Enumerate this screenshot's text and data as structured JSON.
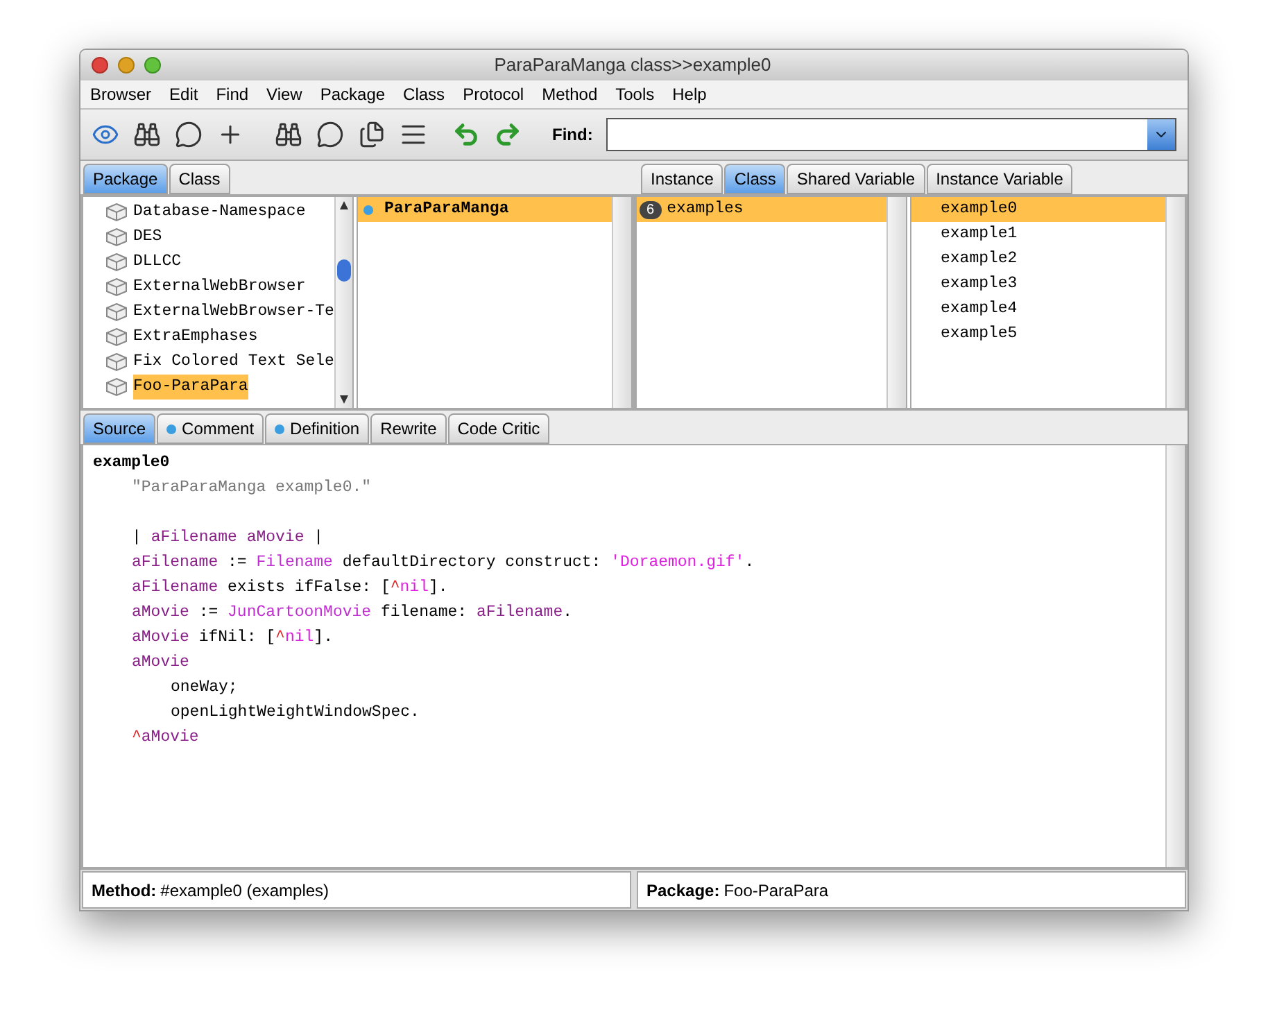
{
  "window": {
    "title": "ParaParaManga class>>example0"
  },
  "menu": [
    "Browser",
    "Edit",
    "Find",
    "View",
    "Package",
    "Class",
    "Protocol",
    "Method",
    "Tools",
    "Help"
  ],
  "find": {
    "label": "Find:"
  },
  "left_tabs": [
    {
      "label": "Package",
      "selected": true
    },
    {
      "label": "Class",
      "selected": false
    }
  ],
  "packages": [
    {
      "name": "Database-Namespace",
      "selected": false
    },
    {
      "name": "DES",
      "selected": false
    },
    {
      "name": "DLLCC",
      "selected": false
    },
    {
      "name": "ExternalWebBrowser",
      "selected": false
    },
    {
      "name": "ExternalWebBrowser-Te",
      "selected": false
    },
    {
      "name": "ExtraEmphases",
      "selected": false
    },
    {
      "name": "Fix Colored Text Sele",
      "selected": false
    },
    {
      "name": "Foo-ParaPara",
      "selected": true
    }
  ],
  "classes": [
    {
      "name": "ParaParaManga",
      "selected": true
    }
  ],
  "right_tabs": [
    {
      "label": "Instance",
      "selected": false
    },
    {
      "label": "Class",
      "selected": true
    },
    {
      "label": "Shared Variable",
      "selected": false
    },
    {
      "label": "Instance Variable",
      "selected": false
    }
  ],
  "protocols": [
    {
      "name": "examples",
      "count": "6",
      "selected": true
    }
  ],
  "methods": [
    {
      "name": "example0",
      "selected": true
    },
    {
      "name": "example1",
      "selected": false
    },
    {
      "name": "example2",
      "selected": false
    },
    {
      "name": "example3",
      "selected": false
    },
    {
      "name": "example4",
      "selected": false
    },
    {
      "name": "example5",
      "selected": false
    }
  ],
  "code_tabs": [
    {
      "label": "Source",
      "selected": true,
      "dot": false
    },
    {
      "label": "Comment",
      "selected": false,
      "dot": true
    },
    {
      "label": "Definition",
      "selected": false,
      "dot": true
    },
    {
      "label": "Rewrite",
      "selected": false,
      "dot": false
    },
    {
      "label": "Code Critic",
      "selected": false,
      "dot": false
    }
  ],
  "code_lines": [
    {
      "gap_before": false,
      "tokens": [
        {
          "kind": "selector",
          "text": "example0"
        }
      ],
      "children": [
        {
          "gap_before": false,
          "tokens": [
            {
              "kind": "comment",
              "text": "\"ParaParaManga example0.\""
            }
          ]
        },
        {
          "gap_before": true,
          "tokens": [
            {
              "kind": "plain",
              "text": "| "
            },
            {
              "kind": "var",
              "text": "aFilename aMovie"
            },
            {
              "kind": "plain",
              "text": " |"
            }
          ]
        },
        {
          "gap_before": false,
          "tokens": [
            {
              "kind": "var",
              "text": "aFilename"
            },
            {
              "kind": "plain",
              "text": " := "
            },
            {
              "kind": "class",
              "text": "Filename"
            },
            {
              "kind": "plain",
              "text": " defaultDirectory construct: "
            },
            {
              "kind": "string",
              "text": "'Doraemon.gif'"
            },
            {
              "kind": "plain",
              "text": "."
            }
          ]
        },
        {
          "gap_before": false,
          "tokens": [
            {
              "kind": "var",
              "text": "aFilename"
            },
            {
              "kind": "plain",
              "text": " exists ifFalse: ["
            },
            {
              "kind": "caret",
              "text": "^"
            },
            {
              "kind": "string",
              "text": "nil"
            },
            {
              "kind": "plain",
              "text": "]."
            }
          ]
        },
        {
          "gap_before": false,
          "tokens": [
            {
              "kind": "var",
              "text": "aMovie"
            },
            {
              "kind": "plain",
              "text": " := "
            },
            {
              "kind": "class",
              "text": "JunCartoonMovie"
            },
            {
              "kind": "plain",
              "text": " filename: "
            },
            {
              "kind": "var",
              "text": "aFilename"
            },
            {
              "kind": "plain",
              "text": "."
            }
          ]
        },
        {
          "gap_before": false,
          "tokens": [
            {
              "kind": "var",
              "text": "aMovie"
            },
            {
              "kind": "plain",
              "text": " ifNil: ["
            },
            {
              "kind": "caret",
              "text": "^"
            },
            {
              "kind": "string",
              "text": "nil"
            },
            {
              "kind": "plain",
              "text": "]."
            }
          ]
        },
        {
          "gap_before": false,
          "tokens": [
            {
              "kind": "var",
              "text": "aMovie"
            }
          ],
          "children": [
            {
              "gap_before": false,
              "tokens": [
                {
                  "kind": "plain",
                  "text": "oneWay;"
                }
              ]
            },
            {
              "gap_before": false,
              "tokens": [
                {
                  "kind": "plain",
                  "text": "openLightWeightWindowSpec."
                }
              ]
            }
          ]
        },
        {
          "gap_before": false,
          "tokens": [
            {
              "kind": "caret",
              "text": "^"
            },
            {
              "kind": "var",
              "text": "aMovie"
            }
          ]
        }
      ]
    }
  ],
  "status_bar": [
    {
      "label": "Method:",
      "value": "#example0 (examples)"
    },
    {
      "label": "Package:",
      "value": "Foo-ParaPara"
    }
  ]
}
